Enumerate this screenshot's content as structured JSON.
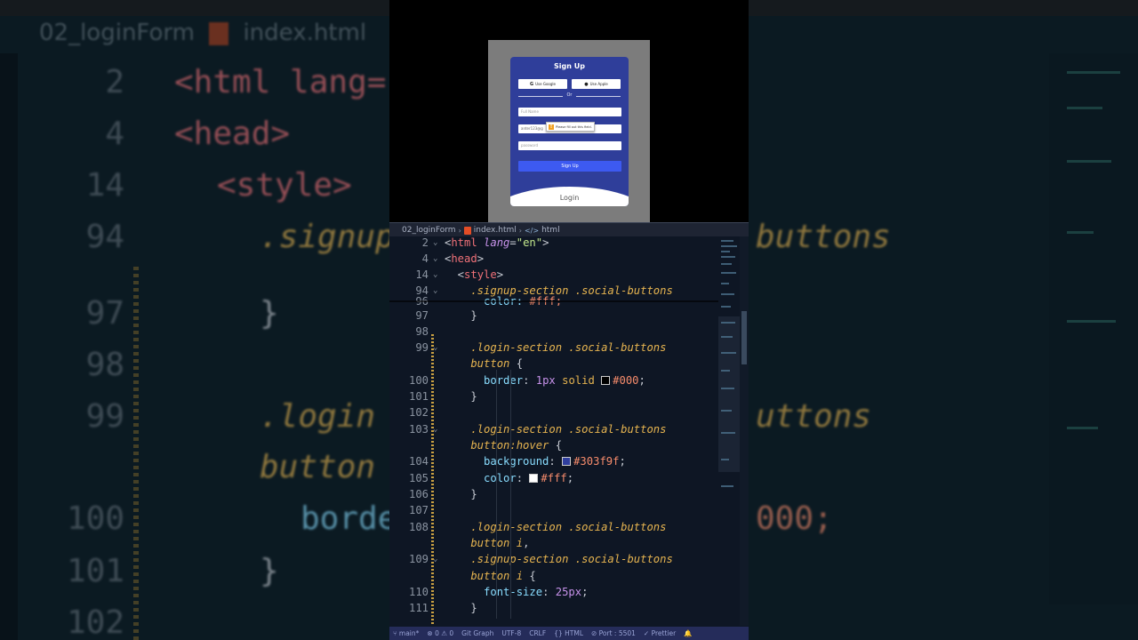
{
  "background": {
    "breadcrumb": [
      "02_loginForm",
      "index.html"
    ],
    "lines": [
      {
        "num": "2",
        "code": "<html lang="
      },
      {
        "num": "4",
        "code": "<head>"
      },
      {
        "num": "14",
        "code": "<style>"
      },
      {
        "num": "94",
        "code": ".signup"
      },
      {
        "num": "97",
        "code": "}"
      },
      {
        "num": "98",
        "code": ""
      },
      {
        "num": "99",
        "code": ".login"
      },
      {
        "num": "",
        "code": "button"
      },
      {
        "num": "100",
        "code": "borde"
      },
      {
        "num": "101",
        "code": "}"
      },
      {
        "num": "102",
        "code": ""
      }
    ],
    "right_fragments": [
      "buttons",
      "uttons",
      "000;"
    ]
  },
  "preview": {
    "title": "Sign Up",
    "google_label": "Use Google",
    "apple_label": "Use Apple",
    "or_label": "Or",
    "fullname_placeholder": "Full Name",
    "email_value": "anter123@g",
    "password_placeholder": "password",
    "tooltip": "Please fill out this field.",
    "signup_button": "Sign Up",
    "login_label": "Login"
  },
  "editor": {
    "breadcrumb": {
      "folder": "02_loginForm",
      "file": "index.html",
      "node": "html"
    },
    "lines": [
      {
        "num": "2",
        "fold": "⌄",
        "segments": [
          [
            "t-punc",
            "<"
          ],
          [
            "t-tag",
            "html "
          ],
          [
            "t-attr",
            "lang"
          ],
          [
            "t-punc",
            "="
          ],
          [
            "t-str",
            "\"en\""
          ],
          [
            "t-punc",
            ">"
          ]
        ]
      },
      {
        "num": "4",
        "fold": "⌄",
        "segments": [
          [
            "t-punc",
            "<"
          ],
          [
            "t-tag",
            "head"
          ],
          [
            "t-punc",
            ">"
          ]
        ]
      },
      {
        "num": "14",
        "fold": "⌄",
        "segments": [
          [
            "t-punc",
            "  <"
          ],
          [
            "t-tag",
            "style"
          ],
          [
            "t-punc",
            ">"
          ]
        ]
      },
      {
        "num": "94",
        "fold": "⌄",
        "segments": [
          [
            "t-sel",
            "    .signup-section .social-buttons"
          ]
        ]
      },
      {
        "num": "96",
        "fold": "",
        "segments": [
          [
            "t-prop",
            "      color: "
          ],
          [
            "t-hex",
            "#fff;"
          ]
        ]
      },
      {
        "num": "97",
        "fold": "",
        "segments": [
          [
            "t-punc",
            "    }"
          ]
        ]
      },
      {
        "num": "98",
        "fold": "",
        "segments": [
          [
            "t-punc",
            ""
          ]
        ]
      },
      {
        "num": "99",
        "fold": "⌄",
        "segments": [
          [
            "t-sel",
            "    .login-section .social-buttons"
          ]
        ]
      },
      {
        "num": "",
        "fold": "",
        "segments": [
          [
            "t-sel",
            "    button "
          ],
          [
            "t-punc",
            "{"
          ]
        ]
      },
      {
        "num": "100",
        "fold": "",
        "segments": [
          [
            "t-prop",
            "      border"
          ],
          [
            "t-punc",
            ": "
          ],
          [
            "t-num",
            "1px "
          ],
          [
            "t-val",
            "solid "
          ],
          [
            "swatch",
            "#000000"
          ],
          [
            "t-hex",
            "#000"
          ],
          [
            "t-punc",
            ";"
          ]
        ]
      },
      {
        "num": "101",
        "fold": "",
        "segments": [
          [
            "t-punc",
            "    }"
          ]
        ]
      },
      {
        "num": "102",
        "fold": "",
        "segments": [
          [
            "t-punc",
            ""
          ]
        ]
      },
      {
        "num": "103",
        "fold": "⌄",
        "segments": [
          [
            "t-sel",
            "    .login-section .social-buttons"
          ]
        ]
      },
      {
        "num": "",
        "fold": "",
        "segments": [
          [
            "t-sel",
            "    button:hover "
          ],
          [
            "t-punc",
            "{"
          ]
        ]
      },
      {
        "num": "104",
        "fold": "",
        "segments": [
          [
            "t-prop",
            "      background"
          ],
          [
            "t-punc",
            ": "
          ],
          [
            "swatch",
            "#303f9f"
          ],
          [
            "t-hex",
            "#303f9f"
          ],
          [
            "t-punc",
            ";"
          ]
        ]
      },
      {
        "num": "105",
        "fold": "",
        "segments": [
          [
            "t-prop",
            "      color"
          ],
          [
            "t-punc",
            ": "
          ],
          [
            "swatch",
            "#ffffff"
          ],
          [
            "t-hex",
            "#fff"
          ],
          [
            "t-punc",
            ";"
          ]
        ]
      },
      {
        "num": "106",
        "fold": "",
        "segments": [
          [
            "t-punc",
            "    }"
          ]
        ]
      },
      {
        "num": "107",
        "fold": "",
        "segments": [
          [
            "t-punc",
            ""
          ]
        ]
      },
      {
        "num": "108",
        "fold": "",
        "segments": [
          [
            "t-sel",
            "    .login-section .social-buttons"
          ]
        ]
      },
      {
        "num": "",
        "fold": "",
        "segments": [
          [
            "t-sel",
            "    button i"
          ],
          [
            "t-punc",
            ","
          ]
        ]
      },
      {
        "num": "109",
        "fold": "⌄",
        "segments": [
          [
            "t-sel",
            "    .signup-section .social-buttons"
          ]
        ]
      },
      {
        "num": "",
        "fold": "",
        "segments": [
          [
            "t-sel",
            "    button i "
          ],
          [
            "t-punc",
            "{"
          ]
        ]
      },
      {
        "num": "110",
        "fold": "",
        "segments": [
          [
            "t-prop",
            "      font-size"
          ],
          [
            "t-punc",
            ": "
          ],
          [
            "t-num",
            "25px"
          ],
          [
            "t-punc",
            ";"
          ]
        ]
      },
      {
        "num": "111",
        "fold": "",
        "segments": [
          [
            "t-punc",
            "    }"
          ]
        ]
      }
    ]
  },
  "statusbar": {
    "branch": "main*",
    "errors": "0",
    "warnings": "0",
    "git_graph": "Git Graph",
    "encoding": "UTF-8",
    "eol": "CRLF",
    "language": "HTML",
    "port": "Port : 5501",
    "formatter": "Prettier"
  }
}
